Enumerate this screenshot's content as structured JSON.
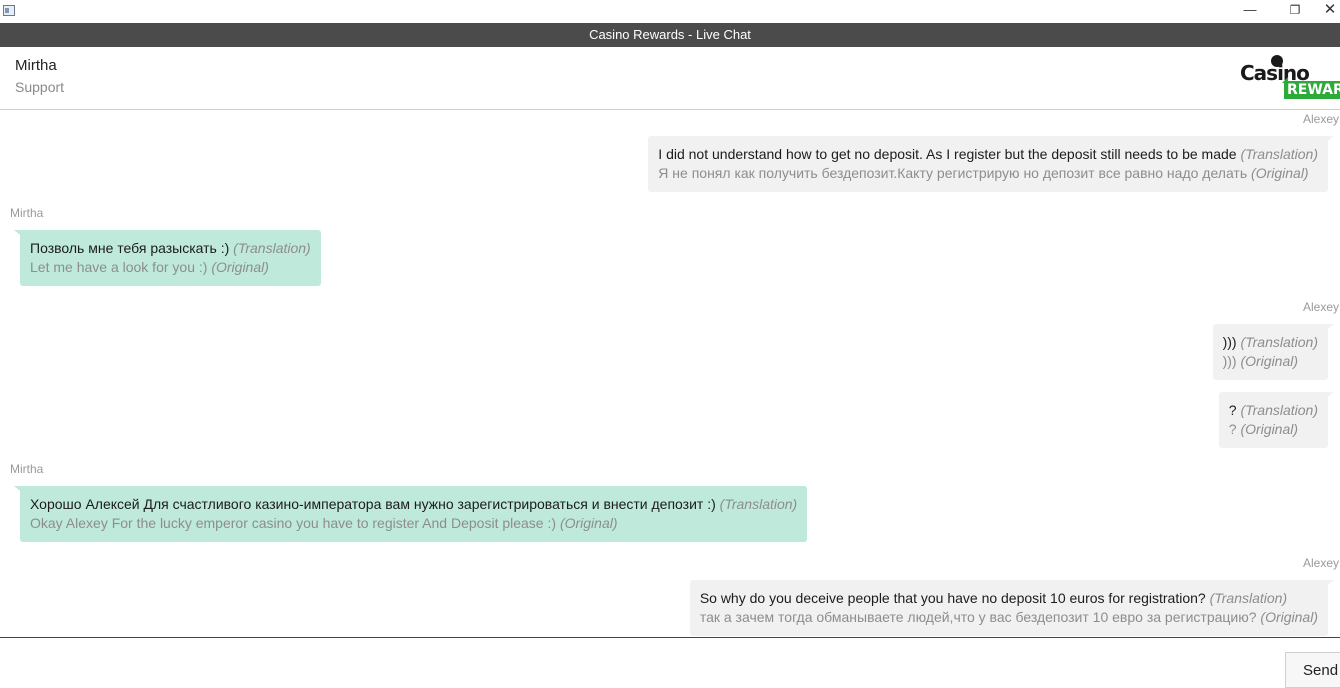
{
  "window": {
    "title": "Casino Rewards - Live Chat",
    "minimize_glyph": "—",
    "restore_glyph": "❐",
    "close_glyph": "✕"
  },
  "agent": {
    "name": "Mirtha",
    "role": "Support"
  },
  "logo": {
    "word1": "Casino",
    "word2": "REWARDS"
  },
  "messages": [
    {
      "sender": "Alexey",
      "line1": "I did not understand how to get no deposit. As I register but the deposit still needs to be made",
      "tag1": "(Translation)",
      "line2": "Я не понял как получить бездепозит.Какту регистрирую но депозит все равно надо делать",
      "tag2": "(Original)"
    },
    {
      "sender": "Mirtha",
      "line1": "Позволь мне тебя разыскать :)",
      "tag1": "(Translation)",
      "line2": "Let me have a look for you :) ",
      "tag2": "(Original)"
    },
    {
      "sender": "Alexey",
      "line1": ")))",
      "tag1": "(Translation)",
      "line2": ")))",
      "tag2": "(Original)"
    },
    {
      "sender": "",
      "line1": "?",
      "tag1": "(Translation)",
      "line2": "?",
      "tag2": "(Original)"
    },
    {
      "sender": "Mirtha",
      "line1": "Хорошо Алексей Для счастливого казино-императора вам нужно зарегистрироваться и внести депозит :)",
      "tag1": "(Translation)",
      "line2": "Okay Alexey For the lucky emperor casino you have to register And Deposit please :) ",
      "tag2": "(Original)"
    },
    {
      "sender": "Alexey",
      "line1": "So why do you deceive people that you have no deposit 10 euros for registration?",
      "tag1": "(Translation)",
      "line2": "так а зачем тогда обманываете людей,что у вас бездепозит 10 евро за регистрацию?",
      "tag2": "(Original)"
    }
  ],
  "composer": {
    "input_value": "",
    "placeholder": "",
    "send_label": "Send"
  },
  "colors": {
    "header_bar": "#4b4b4b",
    "agent_bubble": "#bfeadb",
    "user_bubble": "#f1f1f1",
    "logo_green": "#2eaa3a"
  }
}
